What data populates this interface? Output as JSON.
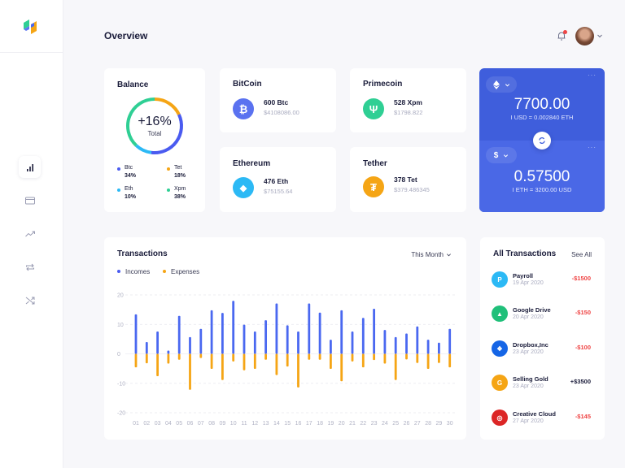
{
  "colors": {
    "primary": "#3f5edc",
    "income": "#4a68f0",
    "expense": "#f5a515",
    "negative": "#ef4444",
    "btc": "#5a72f0",
    "xpm": "#2fcf94",
    "eth": "#2cb9f5",
    "tet": "#f5a515"
  },
  "sidebar": {
    "items": [
      {
        "name": "chart-bars",
        "active": true
      },
      {
        "name": "credit-card",
        "active": false
      },
      {
        "name": "trending-up",
        "active": false
      },
      {
        "name": "repeat",
        "active": false
      },
      {
        "name": "shuffle",
        "active": false
      }
    ]
  },
  "header": {
    "title": "Overview",
    "notification_icon": "bell-icon",
    "has_notification": true
  },
  "balance": {
    "title": "Balance",
    "value": "+16%",
    "label": "Total",
    "legend": [
      {
        "name": "Btc",
        "percent": "34%",
        "color": "#4a5bf0"
      },
      {
        "name": "Tet",
        "percent": "18%",
        "color": "#f5a515"
      },
      {
        "name": "Eth",
        "percent": "10%",
        "color": "#2cb9f5"
      },
      {
        "name": "Xpm",
        "percent": "38%",
        "color": "#2fcf94"
      }
    ]
  },
  "coins": [
    {
      "title": "BitCoin",
      "amount": "600 Btc",
      "usd": "$4108086.00",
      "icon": "₿"
    },
    {
      "title": "Primecoin",
      "amount": "528 Xpm",
      "usd": "$1798.822",
      "icon": "Ψ"
    },
    {
      "title": "Ethereum",
      "amount": "476 Eth",
      "usd": "$75155.64",
      "icon": "◆"
    },
    {
      "title": "Tether",
      "amount": "378 Tet",
      "usd": "$379.486345",
      "icon": "₮"
    }
  ],
  "converter": {
    "from": {
      "currency_icon": "eth-icon",
      "value": "7700.00",
      "rate": "I USD = 0.002840 ETH"
    },
    "to": {
      "currency_symbol": "$",
      "value": "0.57500",
      "rate": "I ETH = 3200.00 USD"
    },
    "more_label": "···"
  },
  "transactions": {
    "title": "Transactions",
    "range_label": "This Month",
    "legend_incomes": "Incomes",
    "legend_expenses": "Expenses"
  },
  "chart_data": {
    "type": "bar",
    "title": "Transactions",
    "xlabel": "",
    "ylabel": "",
    "ylim": [
      -20,
      20
    ],
    "yticks": [
      20,
      10,
      0,
      -10,
      -20
    ],
    "grid": true,
    "legend": "top-left",
    "categories": [
      "01",
      "02",
      "03",
      "04",
      "05",
      "06",
      "07",
      "08",
      "09",
      "10",
      "11",
      "12",
      "13",
      "14",
      "15",
      "16",
      "17",
      "18",
      "19",
      "20",
      "21",
      "22",
      "23",
      "24",
      "25",
      "26",
      "27",
      "28",
      "29",
      "30"
    ],
    "series": [
      {
        "name": "Incomes",
        "values": [
          13.4,
          4.0,
          7.6,
          1.1,
          12.9,
          5.7,
          8.5,
          14.8,
          13.9,
          18.0,
          9.9,
          7.6,
          11.4,
          17.1,
          9.7,
          7.6,
          17.1,
          14.0,
          4.8,
          14.8,
          7.6,
          12.2,
          15.3,
          8.1,
          5.7,
          6.9,
          9.3,
          4.8,
          3.8,
          8.5
        ]
      },
      {
        "name": "Expenses",
        "values": [
          -4.6,
          -3.2,
          -7.6,
          -3.3,
          -2.0,
          -12.2,
          -1.4,
          -5.1,
          -8.9,
          -2.6,
          -5.6,
          -5.1,
          -2.0,
          -7.2,
          -4.3,
          -11.4,
          -2.0,
          -2.0,
          -5.1,
          -9.3,
          -2.6,
          -4.6,
          -2.1,
          -3.3,
          -8.9,
          -1.9,
          -3.1,
          -5.1,
          -3.1,
          -4.6
        ]
      }
    ]
  },
  "all_transactions": {
    "title": "All Transactions",
    "see_all_label": "See All",
    "items": [
      {
        "name": "Payroll",
        "date": "19 Apr 2020",
        "amount": "-$1500",
        "initial": "P",
        "color": "#2cb9f5",
        "negative": true
      },
      {
        "name": "Google Drive",
        "date": "20 Apr 2020",
        "amount": "-$150",
        "initial": "▲",
        "color": "#20c07a",
        "negative": true
      },
      {
        "name": "Dropbox,Inc",
        "date": "23 Apr 2020",
        "amount": "-$100",
        "initial": "❖",
        "color": "#1565e6",
        "negative": true
      },
      {
        "name": "Selling Gold",
        "date": "23 Apr 2020",
        "amount": "+$3500",
        "initial": "G",
        "color": "#f5a515",
        "negative": false
      },
      {
        "name": "Creative Cloud",
        "date": "27 Apr 2020",
        "amount": "-$145",
        "initial": "◎",
        "color": "#dc2626",
        "negative": true
      }
    ]
  }
}
